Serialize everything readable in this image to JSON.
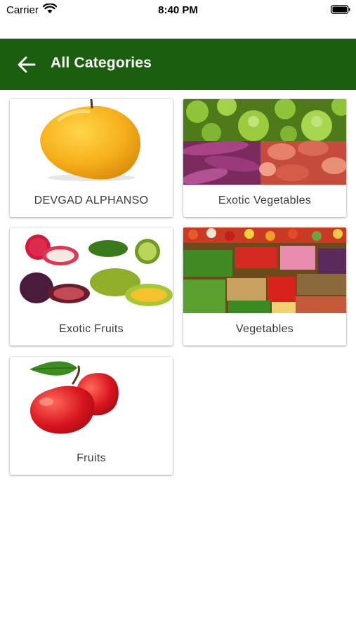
{
  "status_bar": {
    "carrier": "Carrier",
    "time": "8:40 PM"
  },
  "app_bar": {
    "title": "All Categories",
    "back_icon": "arrow-left-icon",
    "background_color": "#1b5e0f"
  },
  "categories": [
    {
      "label": "DEVGAD ALPHANSO",
      "image": "mango-image"
    },
    {
      "label": "Exotic Vegetables",
      "image": "exotic-vegetables-image"
    },
    {
      "label": "Exotic Fruits",
      "image": "exotic-fruits-image"
    },
    {
      "label": "Vegetables",
      "image": "vegetables-market-image"
    },
    {
      "label": "Fruits",
      "image": "apples-image"
    }
  ]
}
